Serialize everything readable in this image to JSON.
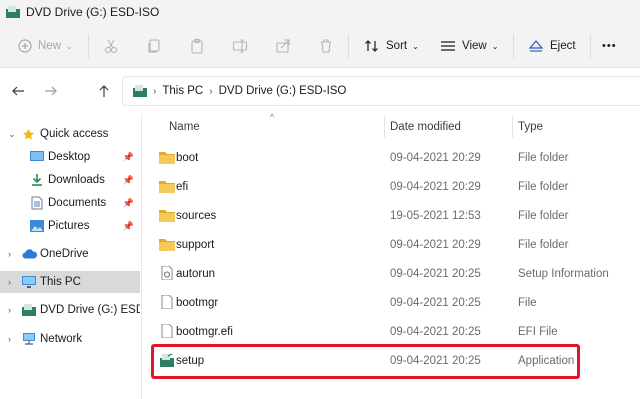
{
  "window": {
    "title": "DVD Drive (G:) ESD-ISO"
  },
  "toolbar": {
    "new_label": "New",
    "sort_label": "Sort",
    "view_label": "View",
    "eject_label": "Eject",
    "more_glyph": "•••"
  },
  "address": {
    "crumbs": [
      "This PC",
      "DVD Drive (G:) ESD-ISO"
    ]
  },
  "sidebar": {
    "quick_access": "Quick access",
    "items": [
      {
        "label": "Desktop",
        "icon": "desktop-icon",
        "pinned": true
      },
      {
        "label": "Downloads",
        "icon": "downloads-icon",
        "pinned": true
      },
      {
        "label": "Documents",
        "icon": "documents-icon",
        "pinned": true
      },
      {
        "label": "Pictures",
        "icon": "pictures-icon",
        "pinned": true
      }
    ],
    "onedrive": "OneDrive",
    "this_pc": "This PC",
    "dvd_drive": "DVD Drive (G:) ESD-ISO",
    "network": "Network"
  },
  "columns": {
    "name": "Name",
    "date": "Date modified",
    "type": "Type"
  },
  "files": [
    {
      "name": "boot",
      "date": "09-04-2021 20:29",
      "type": "File folder",
      "icon": "folder-icon"
    },
    {
      "name": "efi",
      "date": "09-04-2021 20:29",
      "type": "File folder",
      "icon": "folder-icon"
    },
    {
      "name": "sources",
      "date": "19-05-2021 12:53",
      "type": "File folder",
      "icon": "folder-icon"
    },
    {
      "name": "support",
      "date": "09-04-2021 20:29",
      "type": "File folder",
      "icon": "folder-icon"
    },
    {
      "name": "autorun",
      "date": "09-04-2021 20:25",
      "type": "Setup Information",
      "icon": "setup-info-icon"
    },
    {
      "name": "bootmgr",
      "date": "09-04-2021 20:25",
      "type": "File",
      "icon": "file-icon"
    },
    {
      "name": "bootmgr.efi",
      "date": "09-04-2021 20:25",
      "type": "EFI File",
      "icon": "file-icon"
    },
    {
      "name": "setup",
      "date": "09-04-2021 20:25",
      "type": "Application",
      "icon": "setup-app-icon"
    }
  ],
  "colors": {
    "highlight": "#e3142a",
    "folder": "#f2c94c",
    "selected_bg": "#d9d9d9"
  }
}
